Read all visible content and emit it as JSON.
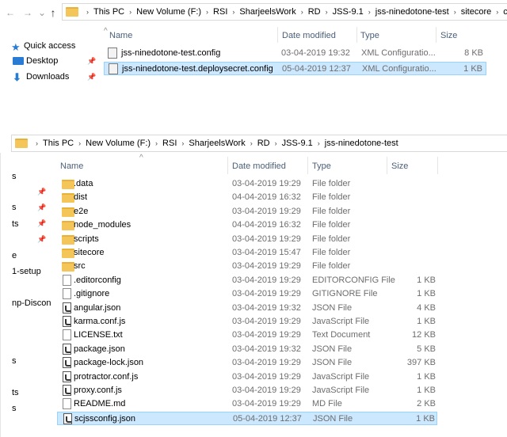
{
  "window1": {
    "nav": {
      "back": "←",
      "forward": "→",
      "recent": "⌄",
      "up": "↑"
    },
    "breadcrumb": [
      "This PC",
      "New Volume (F:)",
      "RSI",
      "SharjeelsWork",
      "RD",
      "JSS-9.1",
      "jss-ninedotone-test",
      "sitecore",
      "config"
    ],
    "headers": {
      "name": "Name",
      "date": "Date modified",
      "type": "Type",
      "size": "Size"
    },
    "sidebar": [
      {
        "label": "Quick access",
        "icon": "star-icon"
      },
      {
        "label": "Desktop",
        "icon": "desktop-icon"
      },
      {
        "label": "Downloads",
        "icon": "download-icon"
      }
    ],
    "files": [
      {
        "name": "jss-ninedotone-test.config",
        "date": "03-04-2019 19:32",
        "type": "XML Configuratio...",
        "size": "8 KB",
        "selected": false
      },
      {
        "name": "jss-ninedotone-test.deploysecret.config",
        "date": "05-04-2019 12:37",
        "type": "XML Configuratio...",
        "size": "1 KB",
        "selected": true
      }
    ]
  },
  "window2": {
    "breadcrumb": [
      "This PC",
      "New Volume (F:)",
      "RSI",
      "SharjeelsWork",
      "RD",
      "JSS-9.1",
      "jss-ninedotone-test"
    ],
    "headers": {
      "name": "Name",
      "date": "Date modified",
      "type": "Type",
      "size": "Size"
    },
    "sidebar_fragments": [
      "s",
      "s",
      "ts",
      "e",
      "1-setup",
      "np-Discon",
      "s",
      "ts",
      "s"
    ],
    "files": [
      {
        "name": ".data",
        "date": "03-04-2019 19:29",
        "type": "File folder",
        "size": "",
        "icon": "folder"
      },
      {
        "name": "dist",
        "date": "04-04-2019 16:32",
        "type": "File folder",
        "size": "",
        "icon": "folder"
      },
      {
        "name": "e2e",
        "date": "03-04-2019 19:29",
        "type": "File folder",
        "size": "",
        "icon": "folder"
      },
      {
        "name": "node_modules",
        "date": "04-04-2019 16:32",
        "type": "File folder",
        "size": "",
        "icon": "folder"
      },
      {
        "name": "scripts",
        "date": "03-04-2019 19:29",
        "type": "File folder",
        "size": "",
        "icon": "folder"
      },
      {
        "name": "sitecore",
        "date": "03-04-2019 15:47",
        "type": "File folder",
        "size": "",
        "icon": "folder"
      },
      {
        "name": "src",
        "date": "03-04-2019 19:29",
        "type": "File folder",
        "size": "",
        "icon": "folder"
      },
      {
        "name": ".editorconfig",
        "date": "03-04-2019 19:29",
        "type": "EDITORCONFIG File",
        "size": "1 KB",
        "icon": "file"
      },
      {
        "name": ".gitignore",
        "date": "03-04-2019 19:29",
        "type": "GITIGNORE File",
        "size": "1 KB",
        "icon": "file"
      },
      {
        "name": "angular.json",
        "date": "03-04-2019 19:32",
        "type": "JSON File",
        "size": "4 KB",
        "icon": "js"
      },
      {
        "name": "karma.conf.js",
        "date": "03-04-2019 19:29",
        "type": "JavaScript File",
        "size": "1 KB",
        "icon": "js"
      },
      {
        "name": "LICENSE.txt",
        "date": "03-04-2019 19:29",
        "type": "Text Document",
        "size": "12 KB",
        "icon": "file"
      },
      {
        "name": "package.json",
        "date": "03-04-2019 19:32",
        "type": "JSON File",
        "size": "5 KB",
        "icon": "js"
      },
      {
        "name": "package-lock.json",
        "date": "03-04-2019 19:29",
        "type": "JSON File",
        "size": "397 KB",
        "icon": "js"
      },
      {
        "name": "protractor.conf.js",
        "date": "03-04-2019 19:29",
        "type": "JavaScript File",
        "size": "1 KB",
        "icon": "js"
      },
      {
        "name": "proxy.conf.js",
        "date": "03-04-2019 19:29",
        "type": "JavaScript File",
        "size": "1 KB",
        "icon": "js"
      },
      {
        "name": "README.md",
        "date": "03-04-2019 19:29",
        "type": "MD File",
        "size": "2 KB",
        "icon": "file"
      },
      {
        "name": "scjssconfig.json",
        "date": "05-04-2019 12:37",
        "type": "JSON File",
        "size": "1 KB",
        "icon": "js",
        "selected": true
      }
    ]
  }
}
